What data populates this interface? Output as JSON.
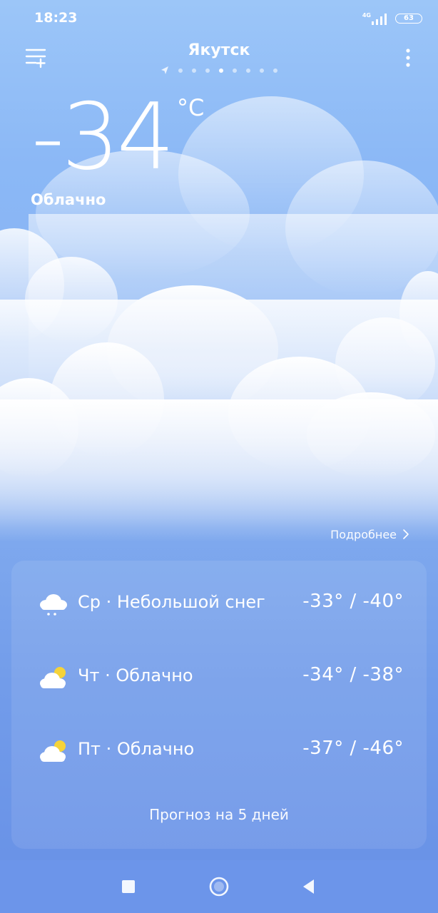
{
  "status_bar": {
    "time": "18:23",
    "network": "4G",
    "battery": "63"
  },
  "header": {
    "city": "Якутск",
    "page_count": 8,
    "active_page": 4
  },
  "current": {
    "temperature": "-34",
    "unit": "°C",
    "condition": "Облачно"
  },
  "details_link": {
    "label": "Подробнее"
  },
  "forecast": {
    "rows": [
      {
        "icon": "snow-cloud-icon",
        "text": "Ср · Небольшой снег",
        "temps": "-33° / -40°"
      },
      {
        "icon": "partly-cloudy-icon",
        "text": "Чт · Облачно",
        "temps": "-34° / -38°"
      },
      {
        "icon": "partly-cloudy-icon",
        "text": "Пт · Облачно",
        "temps": "-37° / -46°"
      }
    ],
    "footer": "Прогноз на 5 дней"
  },
  "nav": {
    "recent_icon": "square-icon",
    "home_icon": "circle-icon",
    "back_icon": "triangle-back-icon"
  },
  "colors": {
    "sky_top": "#9cc6f8",
    "sky_bottom": "#6790e6",
    "sun": "#f5d33a"
  }
}
